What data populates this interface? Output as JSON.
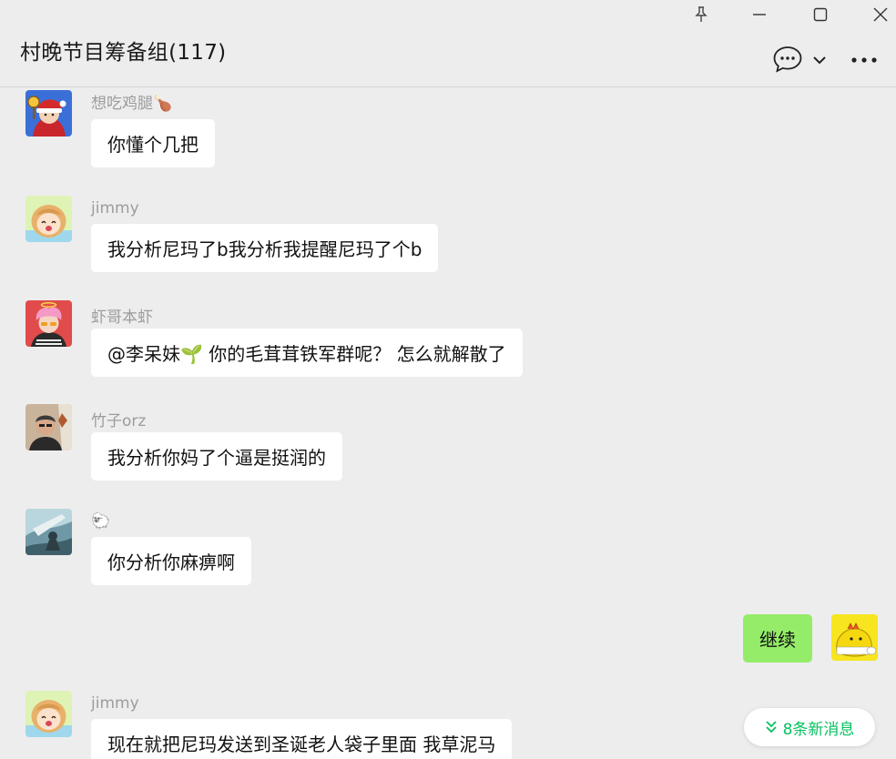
{
  "window": {
    "title": "村晚节目筹备组(117)"
  },
  "messages": [
    {
      "sender": "想吃鸡腿🍗",
      "text": "你懂个几把",
      "avatar": "santa-avatar-icon"
    },
    {
      "sender": "jimmy",
      "text": "我分析尼玛了b我分析我提醒尼玛了个b",
      "avatar": "anime-girl-avatar-icon"
    },
    {
      "sender": "虾哥本虾",
      "text": "@李呆妹🌱 你的毛茸茸铁军群呢？ 怎么就解散了",
      "avatar": "pink-hair-avatar-icon"
    },
    {
      "sender": "竹子orz",
      "text": "我分析你妈了个逼是挺润的",
      "avatar": "man-photo-avatar-icon"
    },
    {
      "sender": "🐑",
      "text": "你分析你麻痹啊",
      "avatar": "sky-character-avatar-icon"
    },
    {
      "sender": "jimmy",
      "text": "现在就把尼玛发送到圣诞老人袋子里面 我草泥马",
      "avatar": "anime-girl-avatar-icon"
    }
  ],
  "self_message": {
    "text": "继续",
    "avatar": "yellow-dino-avatar-icon"
  },
  "new_messages_button": {
    "label": "8条新消息"
  },
  "colors": {
    "background": "#ededed",
    "bubble_other": "#ffffff",
    "bubble_self": "#95ec69",
    "accent": "#07c160",
    "sender_name": "#9c9c9c"
  }
}
